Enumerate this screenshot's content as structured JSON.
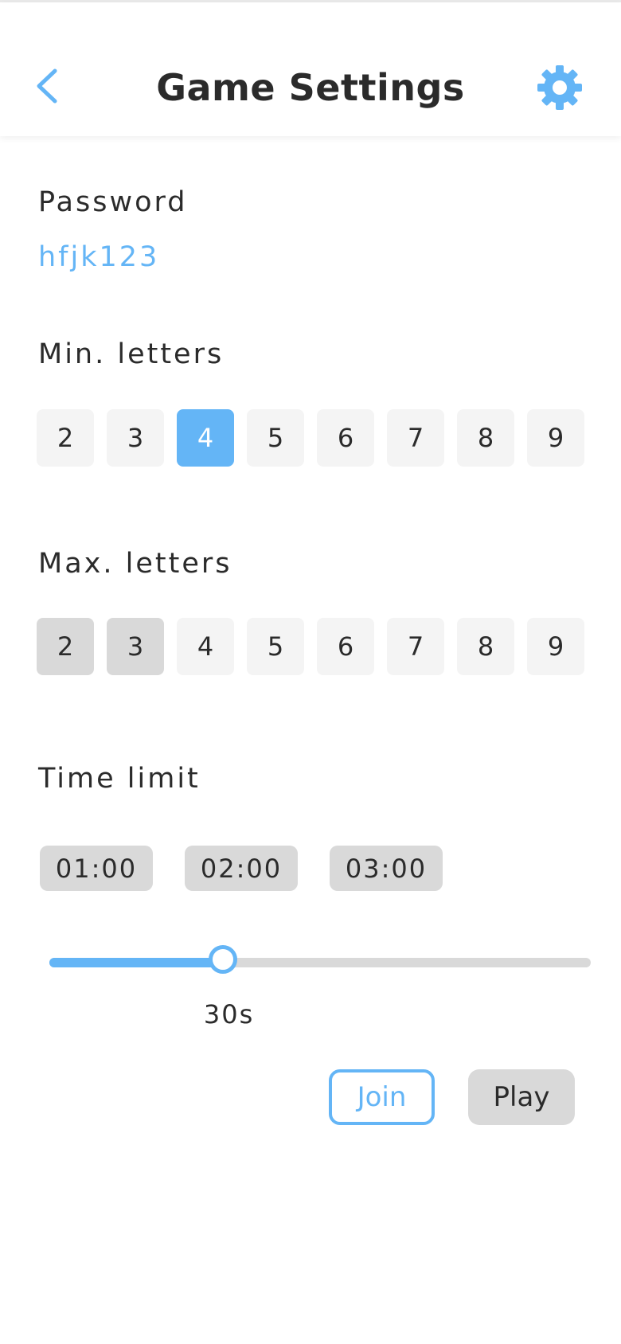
{
  "header": {
    "title": "Game Settings",
    "back_icon": "chevron-left-icon",
    "settings_icon": "gear-icon"
  },
  "password": {
    "label": "Password",
    "value": "hfjk123"
  },
  "min_letters": {
    "label": "Min. letters",
    "options": [
      "2",
      "3",
      "4",
      "5",
      "6",
      "7",
      "8",
      "9"
    ],
    "selected": "4"
  },
  "max_letters": {
    "label": "Max. letters",
    "options": [
      "2",
      "3",
      "4",
      "5",
      "6",
      "7",
      "8",
      "9"
    ],
    "disabled": [
      "2",
      "3"
    ]
  },
  "time_limit": {
    "label": "Time limit",
    "presets": [
      "01:00",
      "02:00",
      "03:00"
    ],
    "slider_value_label": "30s",
    "slider_fraction": 0.32
  },
  "actions": {
    "join_label": "Join",
    "play_label": "Play"
  },
  "colors": {
    "accent": "#64b5f6",
    "chip_bg": "#f4f4f4",
    "chip_disabled_bg": "#d9d9d9",
    "text": "#2b2b2b"
  }
}
